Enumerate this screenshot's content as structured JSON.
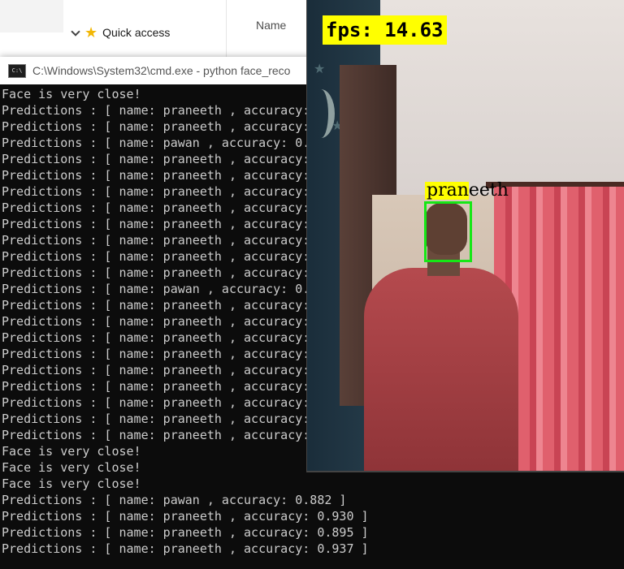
{
  "explorer": {
    "quick_access_label": "Quick access",
    "column_name": "Name"
  },
  "cmd": {
    "title": "C:\\Windows\\System32\\cmd.exe - python  face_reco",
    "icon_text": "C:\\",
    "lines": [
      "Face is very close!",
      "Predictions : [ name: praneeth , accuracy:",
      "Predictions : [ name: praneeth , accuracy:",
      "Predictions : [ name: pawan , accuracy: 0.",
      "Predictions : [ name: praneeth , accuracy:",
      "Predictions : [ name: praneeth , accuracy:",
      "Predictions : [ name: praneeth , accuracy:",
      "Predictions : [ name: praneeth , accuracy:",
      "Predictions : [ name: praneeth , accuracy:",
      "Predictions : [ name: praneeth , accuracy:",
      "Predictions : [ name: praneeth , accuracy:",
      "Predictions : [ name: praneeth , accuracy:",
      "Predictions : [ name: pawan , accuracy: 0.",
      "Predictions : [ name: praneeth , accuracy:",
      "Predictions : [ name: praneeth , accuracy:",
      "Predictions : [ name: praneeth , accuracy:",
      "Predictions : [ name: praneeth , accuracy:",
      "Predictions : [ name: praneeth , accuracy:",
      "Predictions : [ name: praneeth , accuracy:",
      "Predictions : [ name: praneeth , accuracy:",
      "Predictions : [ name: praneeth , accuracy:",
      "Predictions : [ name: praneeth , accuracy:",
      "Face is very close!",
      "Face is very close!",
      "Face is very close!",
      "Predictions : [ name: pawan , accuracy: 0.882 ]",
      "Predictions : [ name: praneeth , accuracy: 0.930 ]",
      "Predictions : [ name: praneeth , accuracy: 0.895 ]",
      "Predictions : [ name: praneeth , accuracy: 0.937 ]"
    ]
  },
  "camera": {
    "fps_label": "fps: 14.63",
    "face_name": "praneeth",
    "label_color": "#ffff00",
    "box_color": "#16e716"
  }
}
